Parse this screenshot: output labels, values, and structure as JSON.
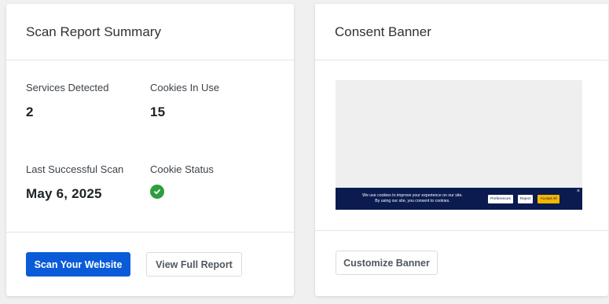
{
  "scan_summary": {
    "title": "Scan Report Summary",
    "services_detected_label": "Services Detected",
    "services_detected_value": "2",
    "cookies_in_use_label": "Cookies In Use",
    "cookies_in_use_value": "15",
    "last_scan_label": "Last Successful Scan",
    "last_scan_value": "May 6, 2025",
    "cookie_status_label": "Cookie Status",
    "cookie_status_icon": "check-circle-icon",
    "scan_button_label": "Scan Your Website",
    "report_button_label": "View Full Report"
  },
  "consent_banner": {
    "title": "Consent Banner",
    "preview_text_line1": "We use cookies to improve your experience on our site.",
    "preview_text_line2": "By using our site, you consent to cookies.",
    "preferences_label": "Preferences",
    "reject_label": "Reject",
    "accept_label": "Accept All",
    "close_glyph": "×",
    "customize_button_label": "Customize Banner"
  },
  "colors": {
    "primary": "#0a5bd8",
    "success": "#2e9e3e",
    "banner_bg": "#0b1b4f",
    "banner_accent": "#f5b700"
  }
}
